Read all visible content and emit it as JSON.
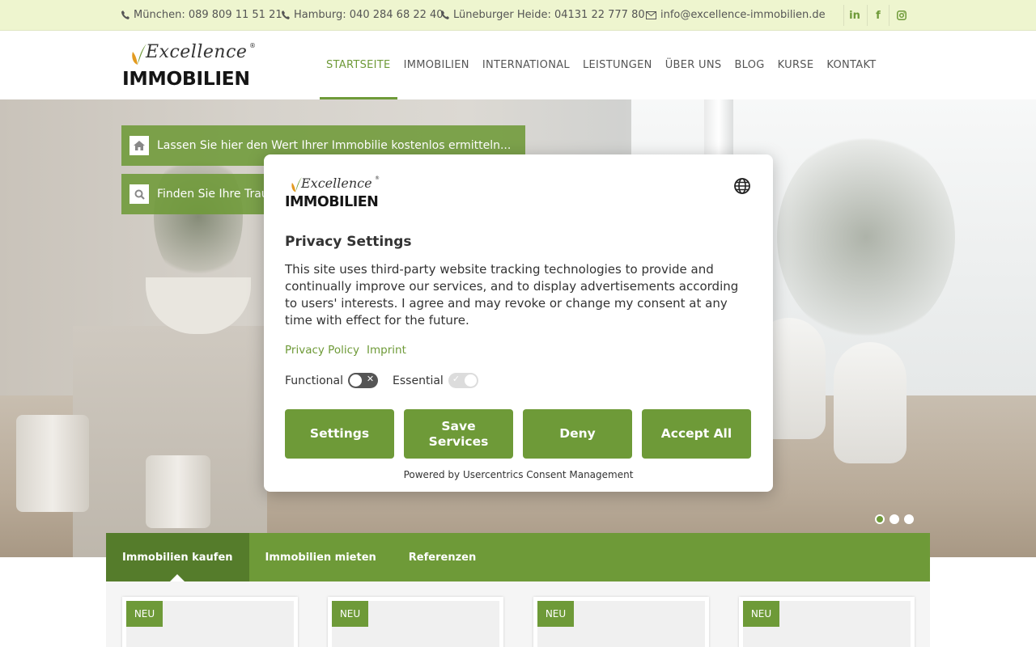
{
  "topbar": {
    "contacts": [
      {
        "label": "München: 089 809 11 51 21",
        "icon": "phone-icon"
      },
      {
        "label": "Hamburg: 040 284 68 22 40",
        "icon": "phone-icon"
      },
      {
        "label": "Lüneburger Heide: 04131 22 777 80",
        "icon": "phone-icon"
      },
      {
        "label": "info@excellence-immobilien.de",
        "icon": "envelope-icon"
      }
    ],
    "social": [
      {
        "label": "in",
        "icon": "linkedin-icon"
      },
      {
        "label": "f",
        "icon": "facebook-icon"
      },
      {
        "label": "",
        "icon": "instagram-icon"
      }
    ]
  },
  "logo": {
    "script": "Excellence",
    "brand": "IMMOBILIEN",
    "reg": "®"
  },
  "nav": {
    "items": [
      {
        "label": "STARTSEITE",
        "active": true
      },
      {
        "label": "IMMOBILIEN"
      },
      {
        "label": "INTERNATIONAL"
      },
      {
        "label": "LEISTUNGEN"
      },
      {
        "label": "ÜBER UNS"
      },
      {
        "label": "BLOG"
      },
      {
        "label": "KURSE"
      },
      {
        "label": "KONTAKT"
      }
    ]
  },
  "hero": {
    "quick_links": [
      {
        "label": "Lassen Sie hier den Wert Ihrer Immobilie kostenlos ermitteln...",
        "icon": "home-icon"
      },
      {
        "label": "Finden Sie Ihre Traumimmobilie",
        "icon": "search-icon"
      }
    ],
    "slider": {
      "count": 3,
      "active": 1
    }
  },
  "tabs": {
    "items": [
      {
        "label": "Immobilien kaufen",
        "active": true
      },
      {
        "label": "Immobilien mieten"
      },
      {
        "label": "Referenzen"
      }
    ]
  },
  "listings": {
    "badges": [
      "NEU",
      "NEU",
      "NEU",
      "NEU"
    ]
  },
  "consent": {
    "logo": {
      "script": "Excellence",
      "brand": "IMMOBILIEN",
      "reg": "®"
    },
    "title": "Privacy Settings",
    "text": "This site uses third-party website tracking technologies to provide and continually improve our services, and to display advertisements according to users' interests. I agree and may revoke or change my consent at any time with effect for the future.",
    "links": {
      "privacy": "Privacy Policy",
      "imprint": "Imprint"
    },
    "toggles": {
      "functional": {
        "label": "Functional",
        "state": "off"
      },
      "essential": {
        "label": "Essential",
        "state": "on-disabled"
      }
    },
    "buttons": {
      "settings": "Settings",
      "save": "Save Services",
      "deny": "Deny",
      "accept": "Accept All"
    },
    "powered": "Powered by Usercentrics Consent Management"
  },
  "colors": {
    "accent": "#6e9a38",
    "accent_dark": "#557c2b",
    "topbar_bg": "#eef5cf"
  }
}
